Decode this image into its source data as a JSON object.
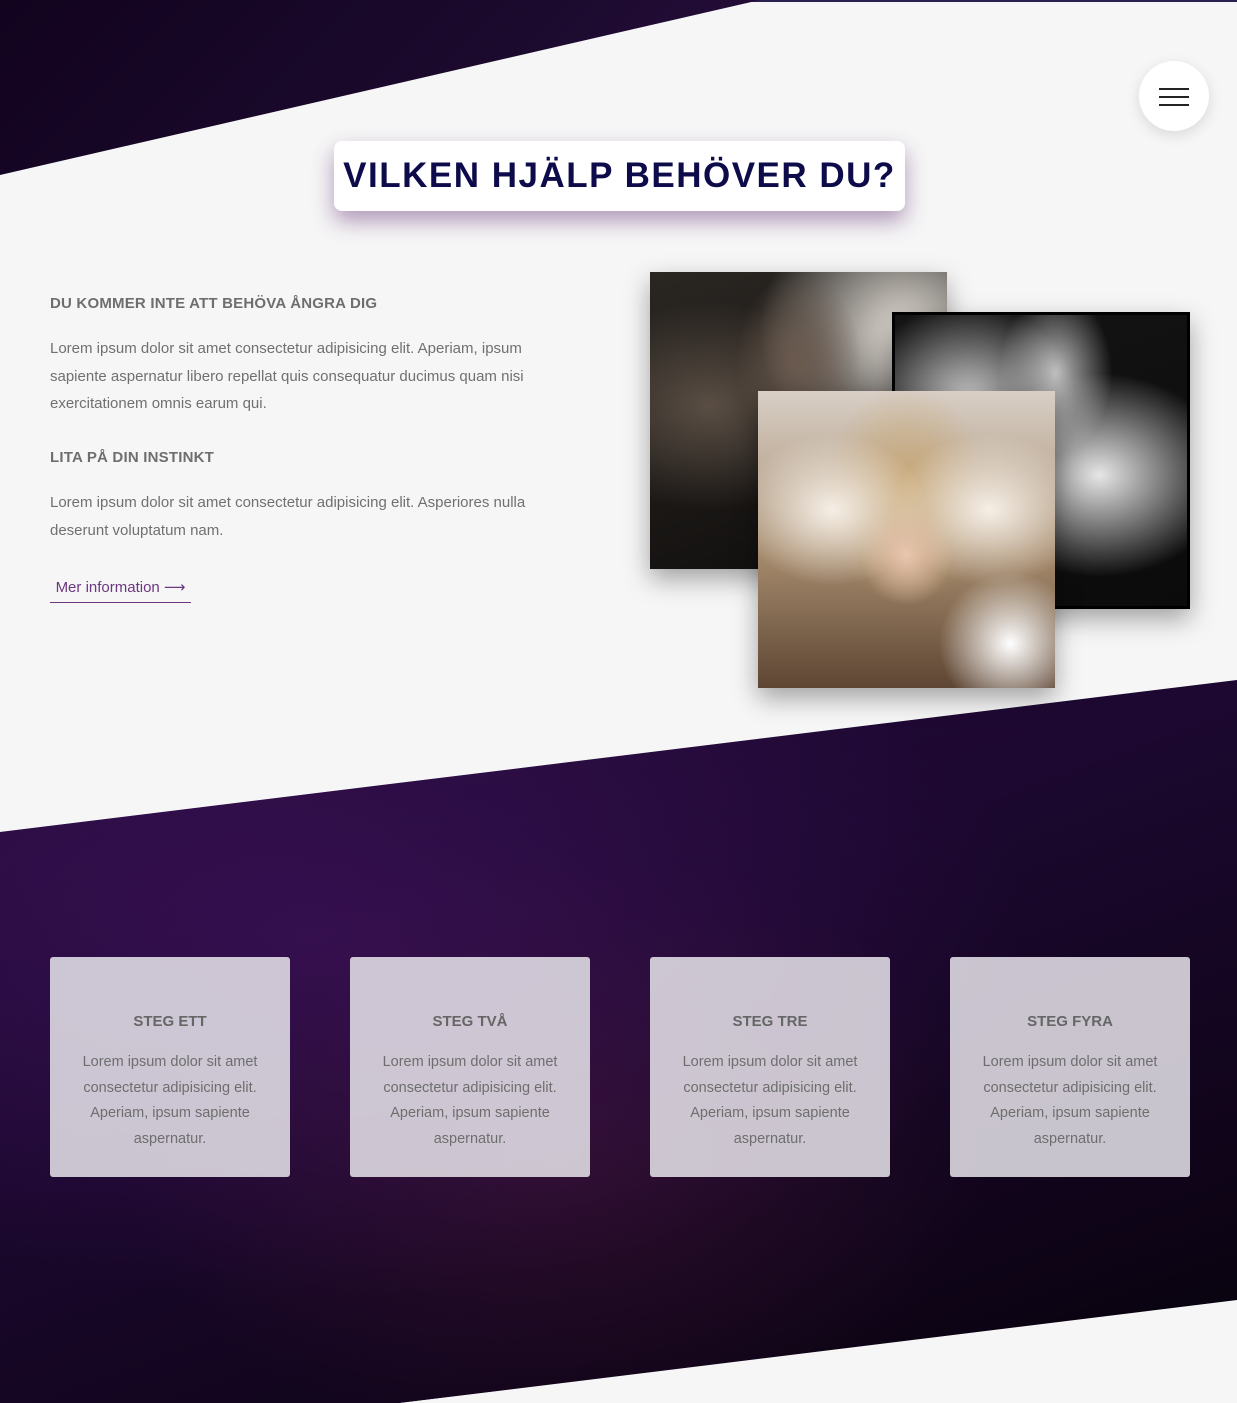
{
  "header": {
    "title": "VILKEN HJÄLP BEHÖVER DU?",
    "menu_icon": "hamburger-icon"
  },
  "intro": {
    "heading_1": "DU KOMMER INTE ATT BEHÖVA ÅNGRA DIG",
    "text_1": "Lorem ipsum dolor sit amet consectetur adipisicing elit. Aperiam, ipsum sapiente aspernatur libero repellat quis consequatur ducimus quam nisi exercitationem omnis earum qui.",
    "heading_2": "LITA PÅ DIN INSTINKT",
    "text_2": "Lorem ipsum dolor sit amet consectetur adipisicing elit. Asperiores nulla deserunt voluptatum nam.",
    "link_label": "Mer information ⟶"
  },
  "steps": [
    {
      "title": "STEG ETT",
      "text": "Lorem ipsum dolor sit amet consectetur adipisicing elit. Aperiam, ipsum sapiente aspernatur."
    },
    {
      "title": "STEG TVÅ",
      "text": "Lorem ipsum dolor sit amet consectetur adipisicing elit. Aperiam, ipsum sapiente aspernatur."
    },
    {
      "title": "STEG TRE",
      "text": "Lorem ipsum dolor sit amet consectetur adipisicing elit. Aperiam, ipsum sapiente aspernatur."
    },
    {
      "title": "STEG FYRA",
      "text": "Lorem ipsum dolor sit amet consectetur adipisicing elit. Aperiam, ipsum sapiente aspernatur."
    }
  ],
  "colors": {
    "title": "#0d0b4a",
    "accent": "#6b3880",
    "dark_bg": "#1c0830",
    "page_bg": "#f6f6f6"
  }
}
